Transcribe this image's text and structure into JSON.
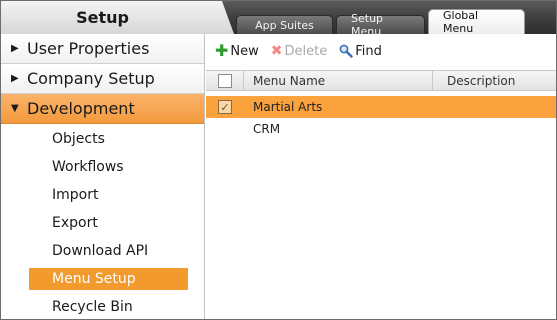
{
  "header": {
    "title": "Setup",
    "tabs": [
      {
        "label": "App Suites",
        "active": false
      },
      {
        "label": "Setup Menu",
        "active": false
      },
      {
        "label": "Global Menu",
        "active": true
      }
    ]
  },
  "sidebar": {
    "sections": [
      {
        "label": "User Properties",
        "expanded": false
      },
      {
        "label": "Company Setup",
        "expanded": false
      },
      {
        "label": "Development",
        "expanded": true
      }
    ],
    "development_items": [
      {
        "label": "Objects"
      },
      {
        "label": "Workflows"
      },
      {
        "label": "Import"
      },
      {
        "label": "Export"
      },
      {
        "label": "Download API"
      },
      {
        "label": "Menu Setup",
        "selected": true
      },
      {
        "label": "Recycle Bin"
      }
    ]
  },
  "toolbar": {
    "new_label": "New",
    "delete_label": "Delete",
    "find_label": "Find"
  },
  "grid": {
    "columns": [
      "Menu Name",
      "Description"
    ],
    "rows": [
      {
        "name": "Martial Arts",
        "description": "",
        "checked": true,
        "selected": true
      },
      {
        "name": "CRM",
        "description": "",
        "checked": false,
        "selected": false
      }
    ]
  },
  "colors": {
    "accent_orange": "#f39a2f",
    "header_dark": "#3a3a3a",
    "new_icon_green": "#2e9a2e",
    "delete_icon_red": "#f08a8a"
  }
}
